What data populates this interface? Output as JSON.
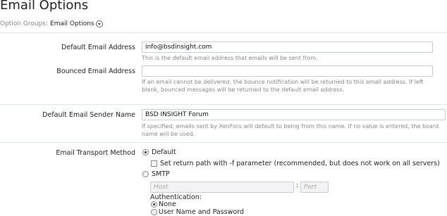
{
  "page": {
    "title": "Email Options",
    "groups_label": "Option Groups:",
    "groups_value": "Email Options"
  },
  "fields": {
    "default_email": {
      "label": "Default Email Address",
      "value": "info@bsdinsight.com",
      "hint": "This is the default email address that emails will be sent from."
    },
    "bounced_email": {
      "label": "Bounced Email Address",
      "value": "",
      "hint": "If an email cannot be delivered, the bounce notification will be returned to this email address. If left blank, bounced messages will be returned to the default email address."
    },
    "sender_name": {
      "label": "Default Email Sender Name",
      "value": "BSD INSIGHT Forum",
      "hint": "If specified, emails sent by XenForo will default to being from this name. If no value is entered, the board name will be used."
    },
    "transport": {
      "label": "Email Transport Method",
      "default_label": "Default",
      "return_path_label": "Set return path with -f parameter (recommended, but does not work on all servers)",
      "smtp_label": "SMTP",
      "host_placeholder": "Host",
      "port_placeholder": "Port",
      "colon": ":",
      "auth_label": "Authentication:",
      "auth_none": "None",
      "auth_userpass": "User Name and Password",
      "selected": "Default"
    }
  }
}
